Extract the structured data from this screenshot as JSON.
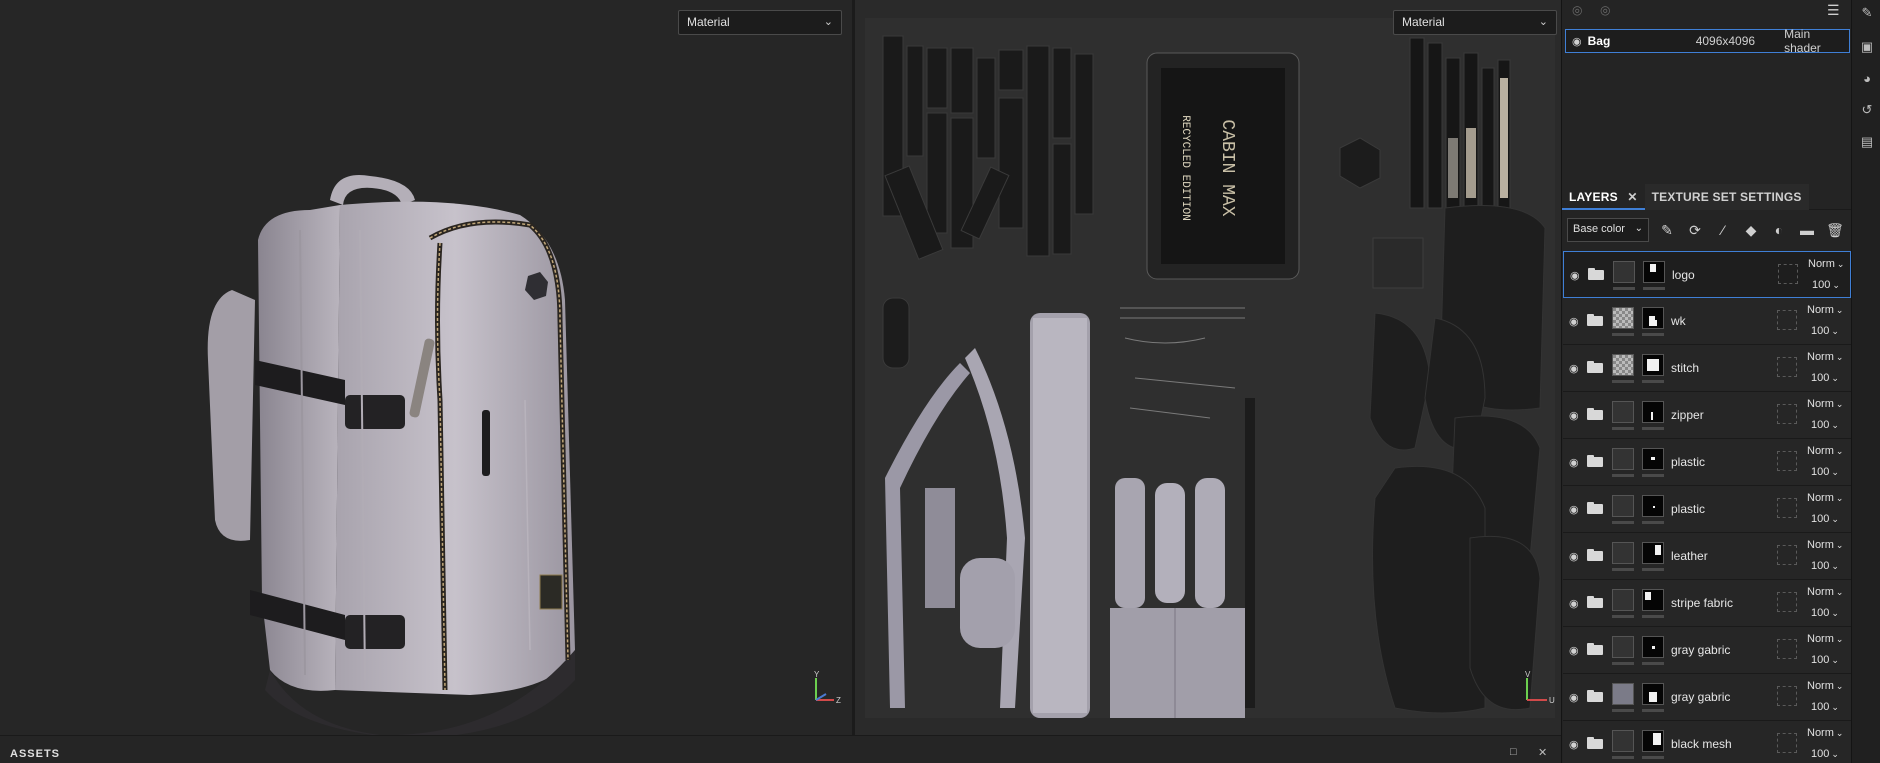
{
  "viewport3d": {
    "mode_select": "Material"
  },
  "viewport2d": {
    "mode_select": "Material"
  },
  "gizmo": {
    "y_label": "Y",
    "x_label": "X",
    "z_label": "Z",
    "u_label": "U",
    "v_label": "V"
  },
  "texture_sets": [
    {
      "name": "Bag",
      "resolution": "4096x4096",
      "shader": "Main shader"
    }
  ],
  "tabs": [
    {
      "label": "LAYERS",
      "active": true
    },
    {
      "label": "TEXTURE SET SETTINGS",
      "active": false
    }
  ],
  "channel_select": "Base color",
  "layers": [
    {
      "name": "logo",
      "blend": "Norm",
      "opacity": "100",
      "thumb": "dark",
      "selected": true
    },
    {
      "name": "wk",
      "blend": "Norm",
      "opacity": "100",
      "thumb": "check",
      "selected": false
    },
    {
      "name": "stitch",
      "blend": "Norm",
      "opacity": "100",
      "thumb": "check",
      "selected": false
    },
    {
      "name": "zipper",
      "blend": "Norm",
      "opacity": "100",
      "thumb": "dark",
      "selected": false
    },
    {
      "name": "plastic",
      "blend": "Norm",
      "opacity": "100",
      "thumb": "dark",
      "selected": false
    },
    {
      "name": "plastic",
      "blend": "Norm",
      "opacity": "100",
      "thumb": "dark",
      "selected": false
    },
    {
      "name": "leather",
      "blend": "Norm",
      "opacity": "100",
      "thumb": "dark",
      "selected": false
    },
    {
      "name": "stripe fabric",
      "blend": "Norm",
      "opacity": "100",
      "thumb": "dark",
      "selected": false
    },
    {
      "name": "gray gabric",
      "blend": "Norm",
      "opacity": "100",
      "thumb": "dark",
      "selected": false
    },
    {
      "name": "gray gabric",
      "blend": "Norm",
      "opacity": "100",
      "thumb": "gray",
      "selected": false
    },
    {
      "name": "black mesh",
      "blend": "Norm",
      "opacity": "100",
      "thumb": "dark",
      "selected": false
    }
  ],
  "patch_text": {
    "line1": "CABIN MAX",
    "line2": "RECYCLED EDITION"
  },
  "bottom_panel": {
    "title": "ASSETS"
  },
  "icons": {
    "eye": "eye-icon",
    "folder": "folder-icon",
    "chevron": "chevron-down-icon",
    "tools": [
      "magic-wand-icon",
      "smart-material-icon",
      "brush-icon",
      "fill-icon",
      "mask-icon",
      "folder-add-icon",
      "trash-icon"
    ],
    "strip": [
      "edit-icon",
      "display-settings-icon",
      "environment-icon",
      "history-icon",
      "log-icon"
    ]
  },
  "colors": {
    "accent": "#3f7fd6",
    "panel": "#242424",
    "viewport": "#262626"
  }
}
